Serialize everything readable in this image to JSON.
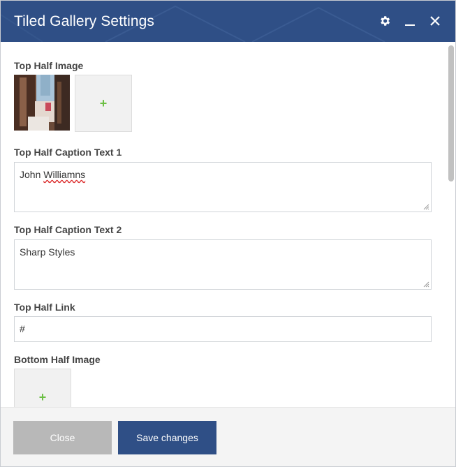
{
  "dialog": {
    "title": "Tiled Gallery Settings",
    "icons": [
      "gear-icon",
      "minimize-icon",
      "close-icon"
    ]
  },
  "fields": {
    "top_image_label": "Top Half Image",
    "top_image_add": "+",
    "caption1_label": "Top Half Caption Text 1",
    "caption1_value_first": "John",
    "caption1_value_second": "Williamns",
    "caption2_label": "Top Half Caption Text 2",
    "caption2_value": "Sharp Styles",
    "link_label": "Top Half Link",
    "link_value": "#",
    "bottom_image_label": "Bottom Half Image",
    "bottom_image_add": "+"
  },
  "footer": {
    "close_label": "Close",
    "save_label": "Save changes"
  },
  "colors": {
    "header": "#2f4f86",
    "save_button": "#2f4f86",
    "close_button": "#b8b8b8",
    "add_plus": "#6cbf44"
  }
}
